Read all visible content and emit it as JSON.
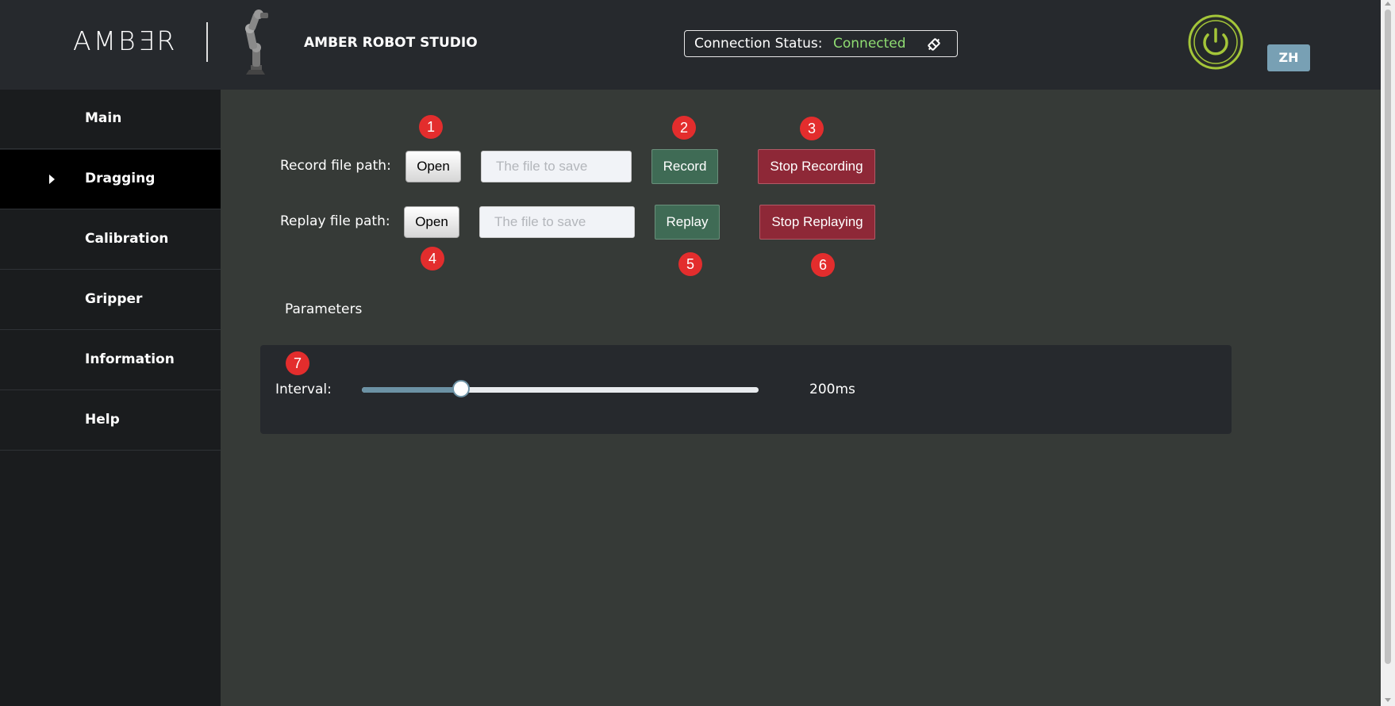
{
  "header": {
    "logo_text": "AMB∃R",
    "studio_title": "AMBER ROBOT STUDIO",
    "connection_label": "Connection Status:",
    "connection_value": "Connected",
    "language_button": "ZH",
    "colors": {
      "header_bg": "#26292d",
      "connected": "#8fdc72",
      "power_ring": "#a4c639",
      "lang_bg": "#78a0b4"
    }
  },
  "sidebar": {
    "items": [
      {
        "label": "Main",
        "active": false
      },
      {
        "label": "Dragging",
        "active": true
      },
      {
        "label": "Calibration",
        "active": false
      },
      {
        "label": "Gripper",
        "active": false
      },
      {
        "label": "Information",
        "active": false
      },
      {
        "label": "Help",
        "active": false
      }
    ]
  },
  "record": {
    "label": "Record file path:",
    "open_label": "Open",
    "placeholder": "The file to save",
    "action_label": "Record",
    "stop_label": "Stop Recording"
  },
  "replay": {
    "label": "Replay file path:",
    "open_label": "Open",
    "placeholder": "The file to save",
    "action_label": "Replay",
    "stop_label": "Stop Replaying"
  },
  "badges": [
    "1",
    "2",
    "3",
    "4",
    "5",
    "6",
    "7"
  ],
  "parameters": {
    "title": "Parameters",
    "interval_label": "Interval:",
    "interval_value": "200ms",
    "slider_fraction": 0.25
  },
  "colors": {
    "main_bg": "#363a37",
    "sidebar_bg": "#1a1c1e",
    "record_green": "#3f6b55",
    "stop_red": "#8e2837",
    "badge_red": "#e32d2d",
    "slider_accent": "#6c92a5"
  }
}
